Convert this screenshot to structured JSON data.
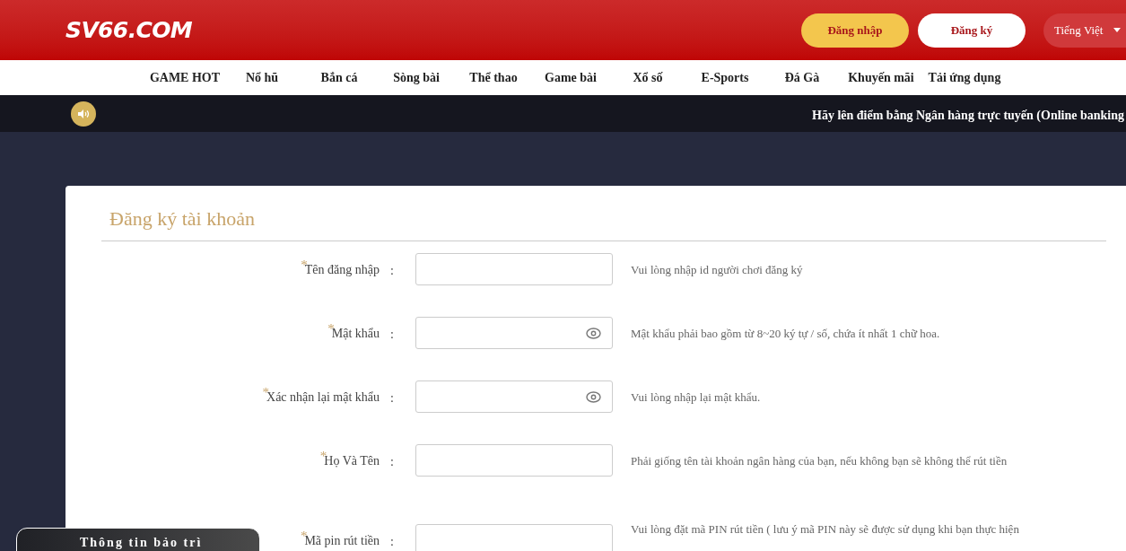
{
  "header": {
    "logo": "SV66.COM",
    "login_button": "Đăng nhập",
    "register_button": "Đăng ký",
    "language": "Tiếng Việt"
  },
  "nav": [
    "GAME HOT",
    "Nổ hũ",
    "Bắn cá",
    "Sòng bài",
    "Thể thao",
    "Game bài",
    "Xổ số",
    "E-Sports",
    "Đá Gà",
    "Khuyến mãi",
    "Tải ứng dụng"
  ],
  "ticker": {
    "text": "Hãy lên điểm bằng Ngân hàng trực tuyến (Online banking"
  },
  "form": {
    "title": "Đăng ký tài khoản",
    "required_mark": "*",
    "separator": ":",
    "fields": [
      {
        "label": "Tên đăng nhập",
        "required": true,
        "kind": "text",
        "hint": "Vui lòng nhập id người chơi đăng ký"
      },
      {
        "label": "Mật khẩu",
        "required": true,
        "kind": "password",
        "hint": "Mật khẩu phải bao gồm từ 8~20 ký tự / số, chứa ít nhất 1 chữ hoa."
      },
      {
        "label": "Xác nhận lại mật khẩu",
        "required": true,
        "kind": "password",
        "hint": "Vui lòng nhập lại mật khẩu."
      },
      {
        "label": "Họ Và Tên",
        "required": true,
        "kind": "text",
        "hint": "Phải giống tên tài khoản ngân hàng của bạn, nếu không bạn sẽ không thể rút tiền"
      },
      {
        "label": "Mã pin rút tiền",
        "required": true,
        "kind": "text",
        "hint": "Vui lòng đặt mã PIN rút tiền ( lưu ý mã PIN này sẽ được sử dụng khi bạn thực hiện"
      }
    ]
  },
  "maintenance_popup": {
    "title": "Thông tin bảo trì"
  }
}
